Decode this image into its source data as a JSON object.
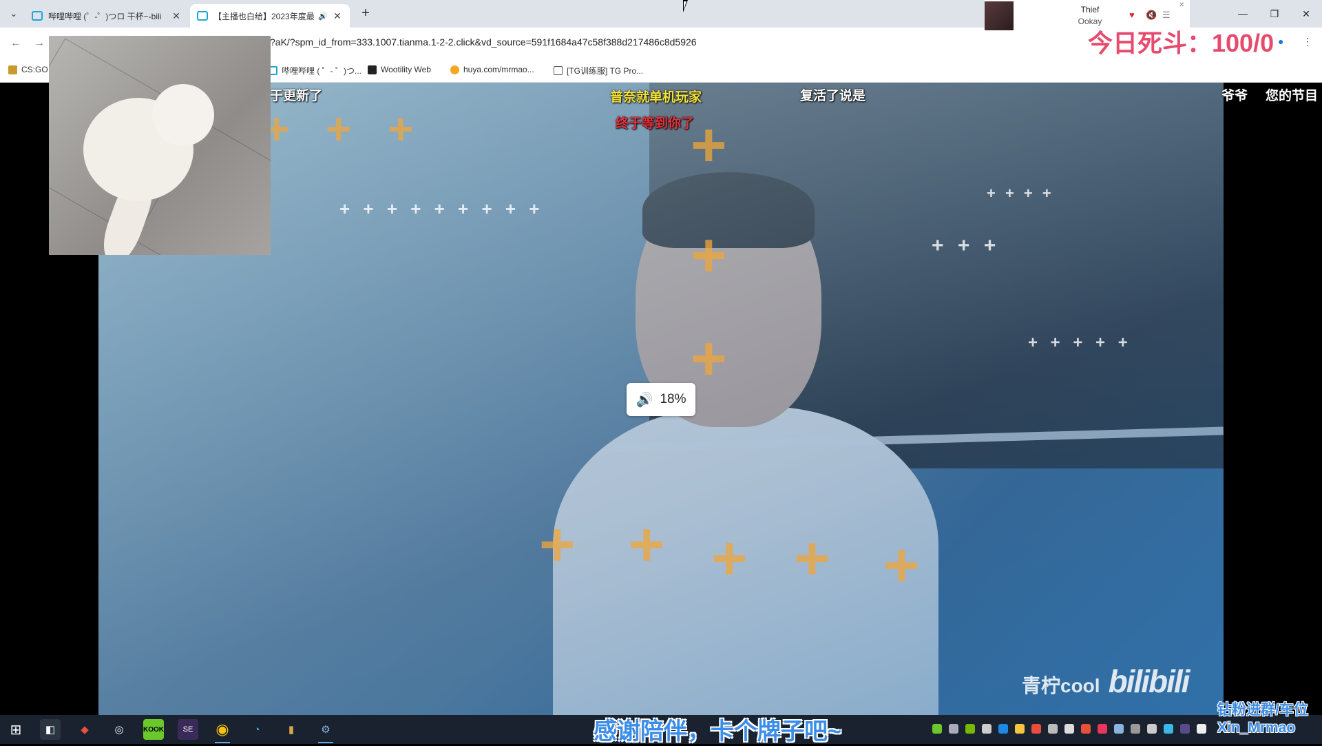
{
  "browser": {
    "tabs": [
      {
        "title": "哔哩哔哩 (゜-゜)つロ 干杯~-bili",
        "active": false
      },
      {
        "title": "【主播也白给】2023年度最...",
        "active": true
      }
    ],
    "url": "?aK/?spm_id_from=333.1007.tianma.1-2-2.click&vd_source=591f1684a47c58f388d217486c8d5926",
    "bookmarks": [
      {
        "label": "CS:GO"
      },
      {
        "label": "哔哩哔哩 ( ゜- ゜)つ..."
      },
      {
        "label": "Wootility Web"
      },
      {
        "label": "huya.com/mrmao..."
      },
      {
        "label": "[TG训练服] TG Pro..."
      }
    ]
  },
  "now_playing": {
    "song": "Thief",
    "artist": "Ookay"
  },
  "overlay": {
    "death_counter": "今日死斗：100/0"
  },
  "video": {
    "volume": "18%",
    "watermark_name": "青柠cool",
    "watermark_logo": "bilibili",
    "danmaku": [
      {
        "text": "于更新了",
        "color": "#ffffff"
      },
      {
        "text": "普奈就单机玩家",
        "color": "#f3e23a"
      },
      {
        "text": "终于等到你了",
        "color": "#e8303a"
      },
      {
        "text": "复活了说是",
        "color": "#ffffff"
      },
      {
        "text": "爷爷",
        "color": "#ffffff"
      },
      {
        "text": "您的节目",
        "color": "#ffffff"
      }
    ]
  },
  "stream_caption": "感谢陪伴，卡个牌子吧~",
  "fan_group": {
    "line1": "钻粉进群/车位",
    "line2": "Xin_Mrmao"
  },
  "icons": {
    "tab_favicon": "bilibili-tv-icon",
    "speaker": "speaker-icon",
    "heart": "heart-icon",
    "mute": "mute-icon",
    "playlist": "playlist-icon"
  }
}
